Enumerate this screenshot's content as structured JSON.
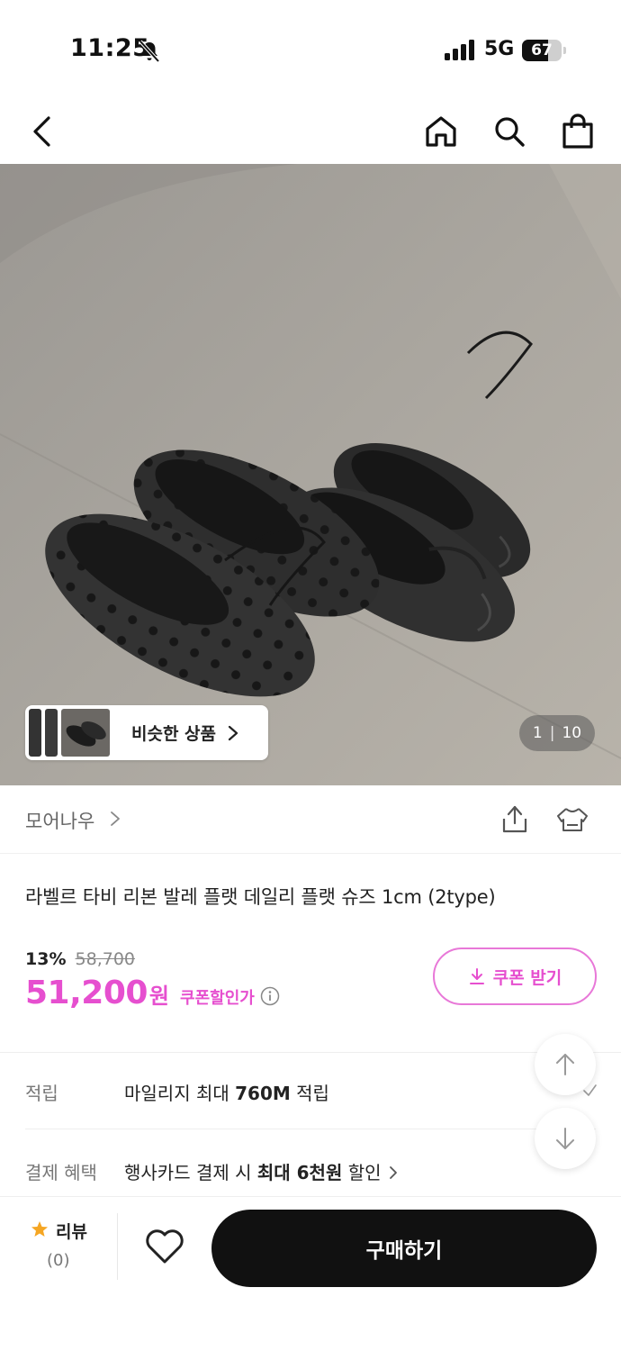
{
  "status_bar": {
    "time": "11:25",
    "network": "5G",
    "battery_percent": 67,
    "battery_text": "67"
  },
  "nav": {
    "back_icon": "chevron-left-icon",
    "home_icon": "home-icon",
    "search_icon": "search-icon",
    "cart_icon": "shopping-bag-icon"
  },
  "gallery": {
    "current_page": "1",
    "page_separator": "|",
    "total_pages": "10",
    "similar_products_label": "비슷한 상품"
  },
  "brand": {
    "name": "모어나우"
  },
  "product": {
    "title": "라벨르 타비 리본 발레 플랫 데일리 플랫 슈즈 1cm (2type)",
    "discount_rate": "13%",
    "original_price": "58,700",
    "sale_price": "51,200",
    "price_unit": "원",
    "coupon_price_label": "쿠폰할인가",
    "coupon_button_label": "쿠폰 받기",
    "accent_color": "#e64fcf"
  },
  "info_rows": {
    "points_label": "적립",
    "points_prefix": "마일리지 최대 ",
    "points_amount": "760M",
    "points_suffix": " 적립",
    "benefit_label": "결제 혜택",
    "benefit_prefix": "행사카드 결제 시 ",
    "benefit_amount": "최대 6천원",
    "benefit_suffix": " 할인"
  },
  "bottom_bar": {
    "review_label": "리뷰",
    "review_count": "(0)",
    "buy_label": "구매하기"
  }
}
